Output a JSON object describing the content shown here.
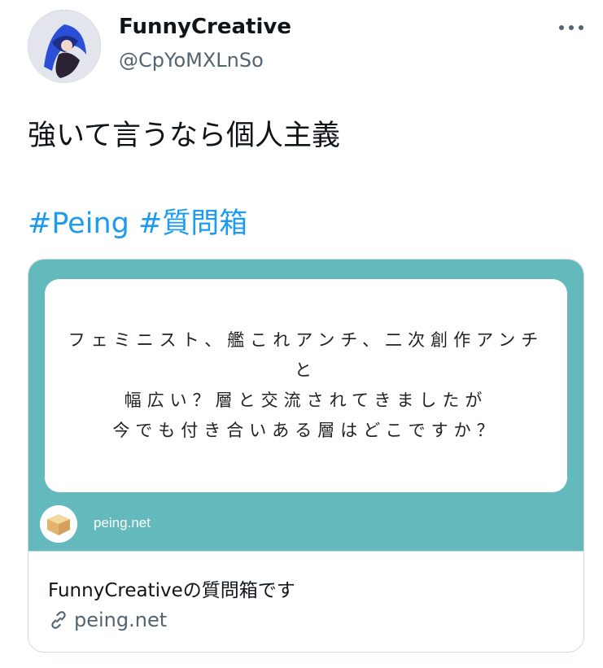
{
  "user": {
    "display_name": "FunnyCreative",
    "handle": "@CpYoMXLnSo"
  },
  "tweet": {
    "text": "強いて言うなら個人主義",
    "hashtags": [
      "#Peing",
      "#質問箱"
    ]
  },
  "card": {
    "question_lines": [
      "フェミニスト、艦これアンチ、二次創作アンチ",
      "と",
      "幅広い？層と交流されてきましたが",
      "今でも付き合いある層はどこですか？"
    ],
    "brand": "peing.net",
    "title": "FunnyCreativeの質問箱です",
    "domain": "peing.net"
  },
  "icons": {
    "more": "more-horizontal-icon",
    "link": "link-icon",
    "logo": "peing-box-logo"
  },
  "colors": {
    "accent": "#1d9bf0",
    "card_teal": "#63b9bb",
    "secondary_text": "#536471"
  }
}
